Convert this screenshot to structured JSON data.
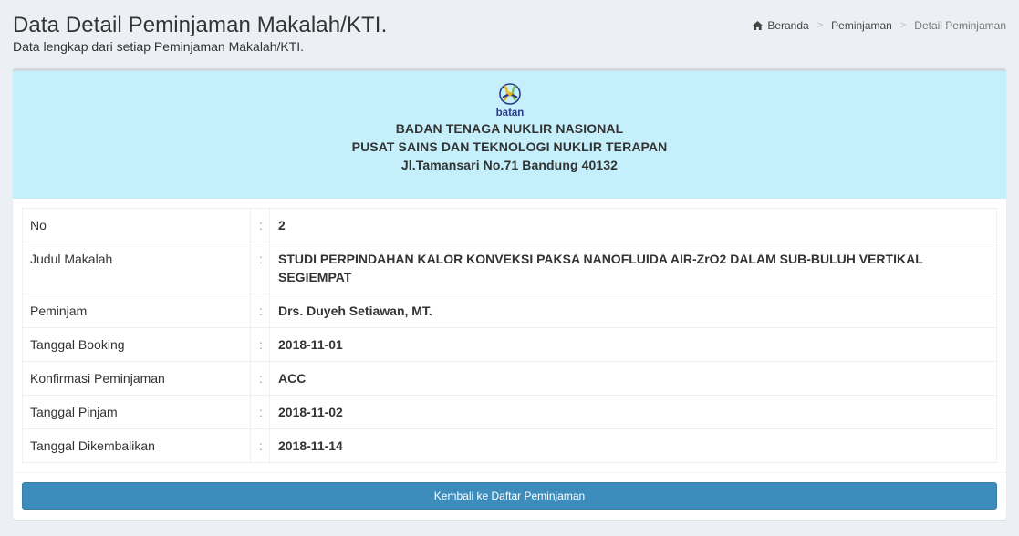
{
  "header": {
    "title": "Data Detail Peminjaman Makalah/KTI.",
    "subtitle": "Data lengkap dari setiap Peminjaman Makalah/KTI."
  },
  "breadcrumb": {
    "icon": "home-icon",
    "items": [
      "Beranda",
      "Peminjaman",
      "Detail Peminjaman"
    ],
    "separator": ">"
  },
  "letterhead": {
    "logo_text": "batan",
    "line1": "BADAN TENAGA NUKLIR NASIONAL",
    "line2": "PUSAT SAINS DAN TEKNOLOGI NUKLIR TERAPAN",
    "line3": "Jl.Tamansari No.71 Bandung 40132",
    "background": "#c5f0fb"
  },
  "details": {
    "colon": ":",
    "rows": [
      {
        "label": "No",
        "value": "2"
      },
      {
        "label": "Judul Makalah",
        "value": "STUDI PERPINDAHAN KALOR KONVEKSI PAKSA NANOFLUIDA AIR-ZrO2 DALAM SUB-BULUH VERTIKAL SEGIEMPAT"
      },
      {
        "label": "Peminjam",
        "value": "Drs. Duyeh Setiawan, MT."
      },
      {
        "label": "Tanggal Booking",
        "value": "2018-11-01"
      },
      {
        "label": "Konfirmasi Peminjaman",
        "value": "ACC"
      },
      {
        "label": "Tanggal Pinjam",
        "value": "2018-11-02"
      },
      {
        "label": "Tanggal Dikembalikan",
        "value": "2018-11-14"
      }
    ]
  },
  "actions": {
    "back_label": "Kembali ke Daftar Peminjaman",
    "accent": "#3c8dbc"
  }
}
